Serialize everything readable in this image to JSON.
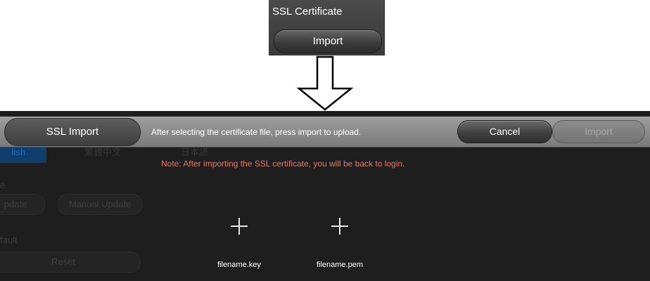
{
  "snippet": {
    "title": "SSL Certificate",
    "import_label": "Import"
  },
  "dialog": {
    "title": "SSL Import",
    "message": "After selecting the certificate file, press import to upload.",
    "cancel_label": "Cancel",
    "import_label": "Import",
    "note": "Note: After importing the SSL certificate, you will be back to login.",
    "files": [
      {
        "label": "filename.key",
        "icon": "plus-icon"
      },
      {
        "label": "filename.pem",
        "icon": "plus-icon"
      }
    ]
  },
  "background": {
    "tabs": [
      "lish",
      "繁體中文",
      "日本語"
    ],
    "update_label": "pdate",
    "manual_update_label": "Manual Update",
    "fault_label": "fault",
    "reset_label": "Reset",
    "section_marker": "e"
  },
  "colors": {
    "panel": "#1e1e1e",
    "header": "#8a8a8a",
    "note": "#e6786c",
    "tab_active": "#0f3d6e"
  }
}
